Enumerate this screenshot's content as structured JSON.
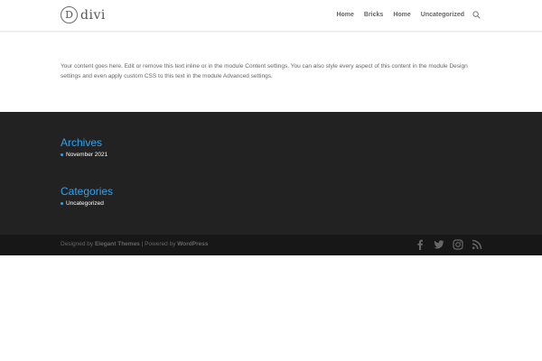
{
  "header": {
    "logo_glyph": "D",
    "logo_text": "divi",
    "nav": [
      "Home",
      "Bricks",
      "Home",
      "Uncategorized"
    ],
    "search_icon": "search-icon"
  },
  "main": {
    "body_text": "Your content goes here. Edit or remove this text inline or in the module Content settings. You can also style every aspect of this content in the module Design settings and even apply custom CSS to this text in the module Advanced settings."
  },
  "footer": {
    "archives_title": "Archives",
    "archives_items": [
      "November 2021"
    ],
    "categories_title": "Categories",
    "categories_items": [
      "Uncategorized"
    ]
  },
  "bottom_bar": {
    "designed_by_prefix": "Designed by",
    "designed_by_link": "Elegant Themes",
    "separator": "|",
    "powered_by_prefix": "Powered by",
    "powered_by_link": "WordPress",
    "social_icons": [
      "facebook-icon",
      "twitter-icon",
      "instagram-icon",
      "rss-icon"
    ]
  },
  "colors": {
    "accent": "#2ea3f2",
    "footer_bg": "#222222",
    "bottom_bar_bg": "#171717",
    "text": "#666666"
  }
}
